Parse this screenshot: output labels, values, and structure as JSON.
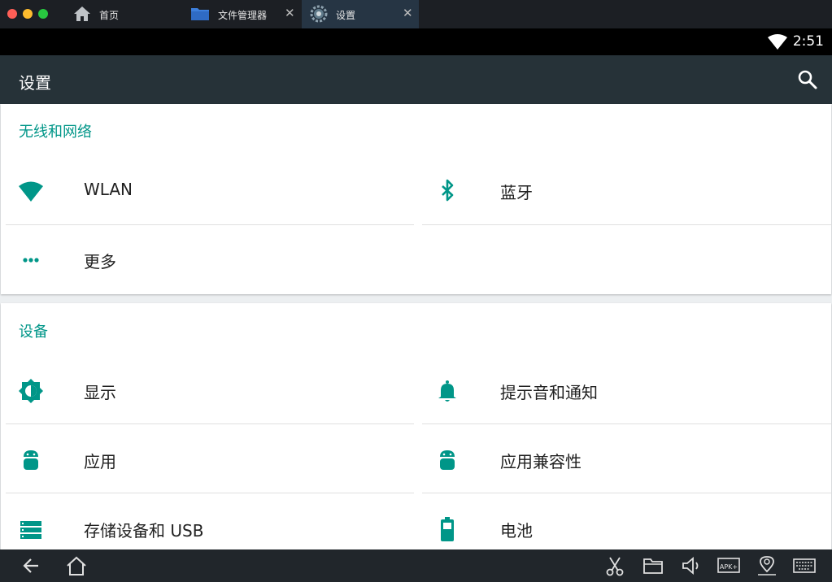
{
  "window": {
    "tabs": [
      {
        "label": "首页",
        "icon": "home-icon"
      },
      {
        "label": "文件管理器",
        "icon": "folder-icon",
        "close": "✕"
      },
      {
        "label": "设置",
        "icon": "settings-gear-icon",
        "close": "✕"
      }
    ]
  },
  "status": {
    "time": "2:51",
    "icon": "wifi-icon"
  },
  "appbar": {
    "title": "设置",
    "icon": "search-icon"
  },
  "sections": [
    {
      "title": "无线和网络",
      "items": [
        {
          "label": "WLAN",
          "icon": "wifi-icon"
        },
        {
          "label": "蓝牙",
          "icon": "bluetooth-icon"
        },
        {
          "label": "更多",
          "icon": "more-dots-icon"
        }
      ]
    },
    {
      "title": "设备",
      "items": [
        {
          "label": "显示",
          "icon": "brightness-icon"
        },
        {
          "label": "提示音和通知",
          "icon": "bell-icon"
        },
        {
          "label": "应用",
          "icon": "android-icon"
        },
        {
          "label": "应用兼容性",
          "icon": "android-icon"
        },
        {
          "label": "存储设备和 USB",
          "icon": "storage-icon"
        },
        {
          "label": "电池",
          "icon": "battery-icon"
        }
      ]
    }
  ],
  "navbar": {
    "left": [
      "back-icon",
      "home-icon"
    ],
    "right": [
      "scissors-icon",
      "folder-icon",
      "volume-icon",
      "apk-install-icon",
      "location-icon",
      "keyboard-icon"
    ],
    "apk_text": "APK+"
  },
  "colors": {
    "accent": "#009688",
    "appbar": "#263238",
    "statusbar": "#000000",
    "titlebar": "#1c1f24"
  }
}
